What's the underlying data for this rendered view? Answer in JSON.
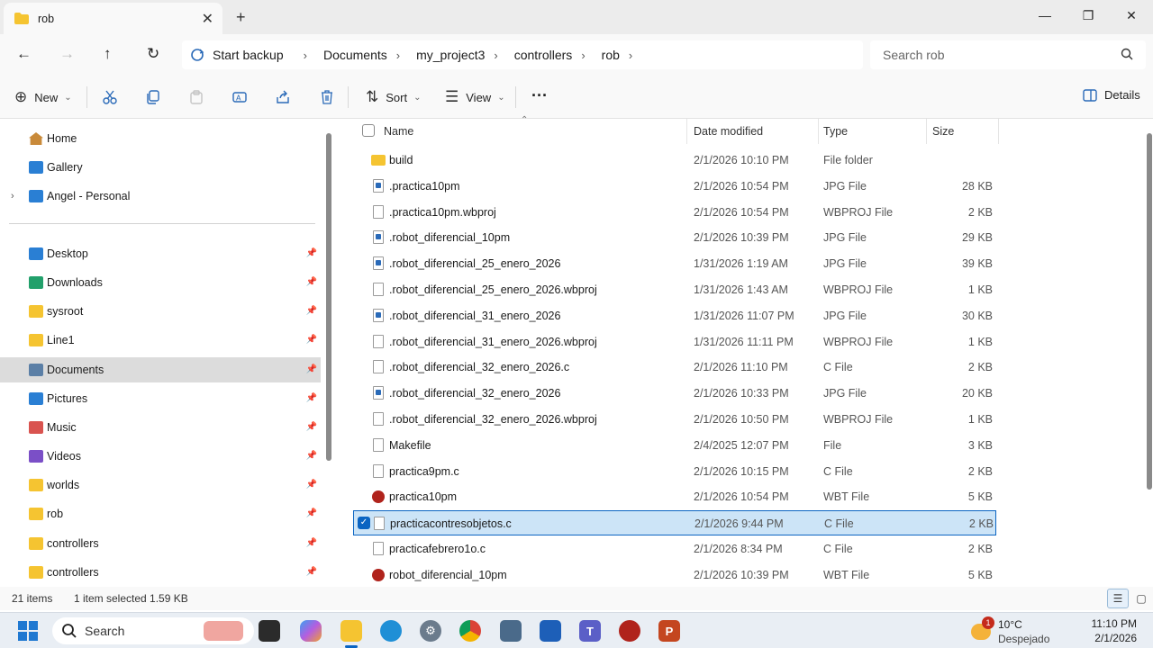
{
  "window": {
    "tab_title": "rob",
    "close_tab": "✕",
    "new_tab": "+",
    "minimize": "—",
    "maximize": "❐",
    "close": "✕"
  },
  "address": {
    "back": "←",
    "forward": "→",
    "up": "↑",
    "refresh": "↻",
    "backup_label": "Start backup",
    "breadcrumbs": [
      "Documents",
      "my_project3",
      "controllers",
      "rob"
    ],
    "search_placeholder": "Search rob"
  },
  "commands": {
    "new_label": "New",
    "sort_label": "Sort",
    "view_label": "View",
    "more": "···",
    "details_label": "Details"
  },
  "sidebar": {
    "top_items": [
      {
        "label": "Home",
        "icon": "home-icon"
      },
      {
        "label": "Gallery",
        "icon": "gallery-icon"
      },
      {
        "label": "Angel - Personal",
        "icon": "cloud-folder-icon"
      }
    ],
    "quick_access": [
      {
        "label": "Desktop",
        "icon": "desktop-icon",
        "color": "#2a7fd4"
      },
      {
        "label": "Downloads",
        "icon": "downloads-icon",
        "color": "#22a06b"
      },
      {
        "label": "sysroot",
        "icon": "folder-icon",
        "color": "#f5c431"
      },
      {
        "label": "Line1",
        "icon": "folder-icon",
        "color": "#f5c431"
      },
      {
        "label": "Documents",
        "icon": "documents-icon",
        "color": "#5b7fa6"
      },
      {
        "label": "Pictures",
        "icon": "pictures-icon",
        "color": "#2a7fd4"
      },
      {
        "label": "Music",
        "icon": "music-icon",
        "color": "#d9534f"
      },
      {
        "label": "Videos",
        "icon": "videos-icon",
        "color": "#7b4fc7"
      },
      {
        "label": "worlds",
        "icon": "folder-icon",
        "color": "#f5c431"
      },
      {
        "label": "rob",
        "icon": "folder-icon",
        "color": "#f5c431"
      },
      {
        "label": "controllers",
        "icon": "folder-icon",
        "color": "#f5c431"
      },
      {
        "label": "controllers",
        "icon": "folder-icon",
        "color": "#f5c431"
      }
    ],
    "selected": "Documents"
  },
  "list": {
    "columns": {
      "name": "Name",
      "date": "Date modified",
      "type": "Type",
      "size": "Size"
    },
    "rows": [
      {
        "name": "build",
        "date": "2/1/2026 10:10 PM",
        "type": "File folder",
        "size": "",
        "icon": "folder"
      },
      {
        "name": ".practica10pm",
        "date": "2/1/2026 10:54 PM",
        "type": "JPG File",
        "size": "28 KB",
        "icon": "jpg"
      },
      {
        "name": ".practica10pm.wbproj",
        "date": "2/1/2026 10:54 PM",
        "type": "WBPROJ File",
        "size": "2 KB",
        "icon": "doc"
      },
      {
        "name": ".robot_diferencial_10pm",
        "date": "2/1/2026 10:39 PM",
        "type": "JPG File",
        "size": "29 KB",
        "icon": "jpg"
      },
      {
        "name": ".robot_diferencial_25_enero_2026",
        "date": "1/31/2026 1:19 AM",
        "type": "JPG File",
        "size": "39 KB",
        "icon": "jpg"
      },
      {
        "name": ".robot_diferencial_25_enero_2026.wbproj",
        "date": "1/31/2026 1:43 AM",
        "type": "WBPROJ File",
        "size": "1 KB",
        "icon": "doc"
      },
      {
        "name": ".robot_diferencial_31_enero_2026",
        "date": "1/31/2026 11:07 PM",
        "type": "JPG File",
        "size": "30 KB",
        "icon": "jpg"
      },
      {
        "name": ".robot_diferencial_31_enero_2026.wbproj",
        "date": "1/31/2026 11:11 PM",
        "type": "WBPROJ File",
        "size": "1 KB",
        "icon": "doc"
      },
      {
        "name": ".robot_diferencial_32_enero_2026.c",
        "date": "2/1/2026 11:10 PM",
        "type": "C File",
        "size": "2 KB",
        "icon": "doc"
      },
      {
        "name": ".robot_diferencial_32_enero_2026",
        "date": "2/1/2026 10:33 PM",
        "type": "JPG File",
        "size": "20 KB",
        "icon": "jpg"
      },
      {
        "name": ".robot_diferencial_32_enero_2026.wbproj",
        "date": "2/1/2026 10:50 PM",
        "type": "WBPROJ File",
        "size": "1 KB",
        "icon": "doc"
      },
      {
        "name": "Makefile",
        "date": "2/4/2025 12:07 PM",
        "type": "File",
        "size": "3 KB",
        "icon": "doc"
      },
      {
        "name": "practica9pm.c",
        "date": "2/1/2026 10:15 PM",
        "type": "C File",
        "size": "2 KB",
        "icon": "doc"
      },
      {
        "name": "practica10pm",
        "date": "2/1/2026 10:54 PM",
        "type": "WBT File",
        "size": "5 KB",
        "icon": "bug"
      },
      {
        "name": "practicacontresobjetos.c",
        "date": "2/1/2026 9:44 PM",
        "type": "C File",
        "size": "2 KB",
        "icon": "doc",
        "selected": true
      },
      {
        "name": "practicafebrero1o.c",
        "date": "2/1/2026 8:34 PM",
        "type": "C File",
        "size": "2 KB",
        "icon": "doc"
      },
      {
        "name": "robot_diferencial_10pm",
        "date": "2/1/2026 10:39 PM",
        "type": "WBT File",
        "size": "5 KB",
        "icon": "bug"
      }
    ]
  },
  "status": {
    "items": "21 items",
    "selected": "1 item selected  1.59 KB"
  },
  "taskbar": {
    "search_label": "Search",
    "weather_badge": "1",
    "temperature": "10°C",
    "condition": "Despejado",
    "time": "11:10 PM",
    "date": "2/1/2026"
  }
}
